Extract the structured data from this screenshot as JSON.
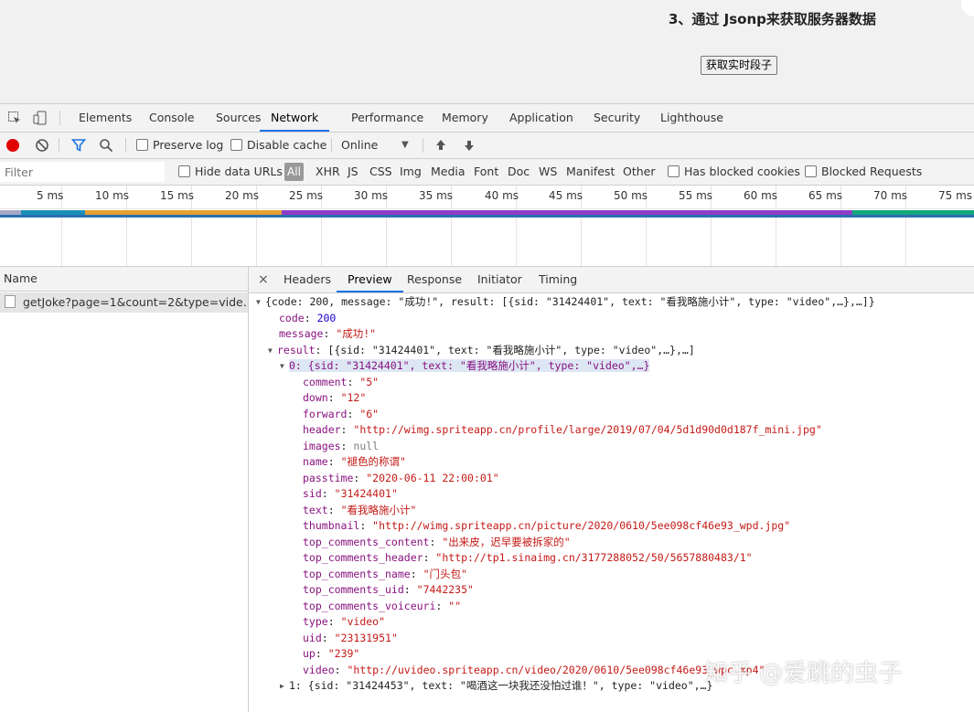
{
  "page": {
    "heading": "3、通过 Jsonp来获取服务器数据",
    "button_label": "获取实时段子"
  },
  "devtools": {
    "tabs": [
      "Elements",
      "Console",
      "Sources",
      "Network",
      "Performance",
      "Memory",
      "Application",
      "Security",
      "Lighthouse"
    ],
    "active_tab": "Network",
    "toolbar": {
      "preserve_log": "Preserve log",
      "disable_cache": "Disable cache",
      "throttle": "Online"
    },
    "filter": {
      "placeholder": "Filter",
      "hide_data_urls": "Hide data URLs",
      "all": "All",
      "types": [
        "XHR",
        "JS",
        "CSS",
        "Img",
        "Media",
        "Font",
        "Doc",
        "WS",
        "Manifest",
        "Other"
      ],
      "has_blocked_cookies": "Has blocked cookies",
      "blocked_requests": "Blocked Requests"
    },
    "timeline_ticks": [
      "5 ms",
      "10 ms",
      "15 ms",
      "20 ms",
      "25 ms",
      "30 ms",
      "35 ms",
      "40 ms",
      "45 ms",
      "50 ms",
      "55 ms",
      "60 ms",
      "65 ms",
      "70 ms",
      "75 ms"
    ],
    "name_header": "Name",
    "request_name": "getJoke?page=1&count=2&type=vide...",
    "detail_tabs": [
      "Headers",
      "Preview",
      "Response",
      "Initiator",
      "Timing"
    ],
    "active_detail_tab": "Preview",
    "close_symbol": "×",
    "preview": {
      "summary": "{code: 200, message: \"成功!\", result: [{sid: \"31424401\", text: \"看我略施小计\", type: \"video\",…},…]}",
      "code_key": "code",
      "code_value": "200",
      "message_key": "message",
      "message_value": "\"成功!\"",
      "result_key": "result",
      "result_summary": "[{sid: \"31424401\", text: \"看我略施小计\", type: \"video\",…},…]",
      "item0_label": "0: {sid: \"31424401\", text: \"看我略施小计\", type: \"video\",…}",
      "item0_fields": [
        {
          "key": "comment",
          "value": "\"5\""
        },
        {
          "key": "down",
          "value": "\"12\""
        },
        {
          "key": "forward",
          "value": "\"6\""
        },
        {
          "key": "header",
          "value": "\"http://wimg.spriteapp.cn/profile/large/2019/07/04/5d1d90d0d187f_mini.jpg\""
        },
        {
          "key": "images",
          "value": "null"
        },
        {
          "key": "name",
          "value": "\"褪色的称谓\""
        },
        {
          "key": "passtime",
          "value": "\"2020-06-11 22:00:01\""
        },
        {
          "key": "sid",
          "value": "\"31424401\""
        },
        {
          "key": "text",
          "value": "\"看我略施小计\""
        },
        {
          "key": "thumbnail",
          "value": "\"http://wimg.spriteapp.cn/picture/2020/0610/5ee098cf46e93_wpd.jpg\""
        },
        {
          "key": "top_comments_content",
          "value": "\"出来皮，迟早要被拆家的\""
        },
        {
          "key": "top_comments_header",
          "value": "\"http://tp1.sinaimg.cn/3177288052/50/5657880483/1\""
        },
        {
          "key": "top_comments_name",
          "value": "\"门头包\""
        },
        {
          "key": "top_comments_uid",
          "value": "\"7442235\""
        },
        {
          "key": "top_comments_voiceuri",
          "value": "\"\""
        },
        {
          "key": "type",
          "value": "\"video\""
        },
        {
          "key": "uid",
          "value": "\"23131951\""
        },
        {
          "key": "up",
          "value": "\"239\""
        },
        {
          "key": "video",
          "value": "\"http://uvideo.spriteapp.cn/video/2020/0610/5ee098cf46e93_wpc.mp4\""
        }
      ],
      "item1_label": "1: {sid: \"31424453\", text: \"喝酒这一块我还没怕过谁！\", type: \"video\",…}"
    }
  },
  "watermark": "知乎 @爱跳的虫子",
  "colors": {
    "accent_tab": "#1a73e8",
    "record": "#e00000",
    "filter_icon": "#1a73e8",
    "json_key": "#881280",
    "json_string": "#c41a16",
    "json_number": "#1c00cf"
  }
}
